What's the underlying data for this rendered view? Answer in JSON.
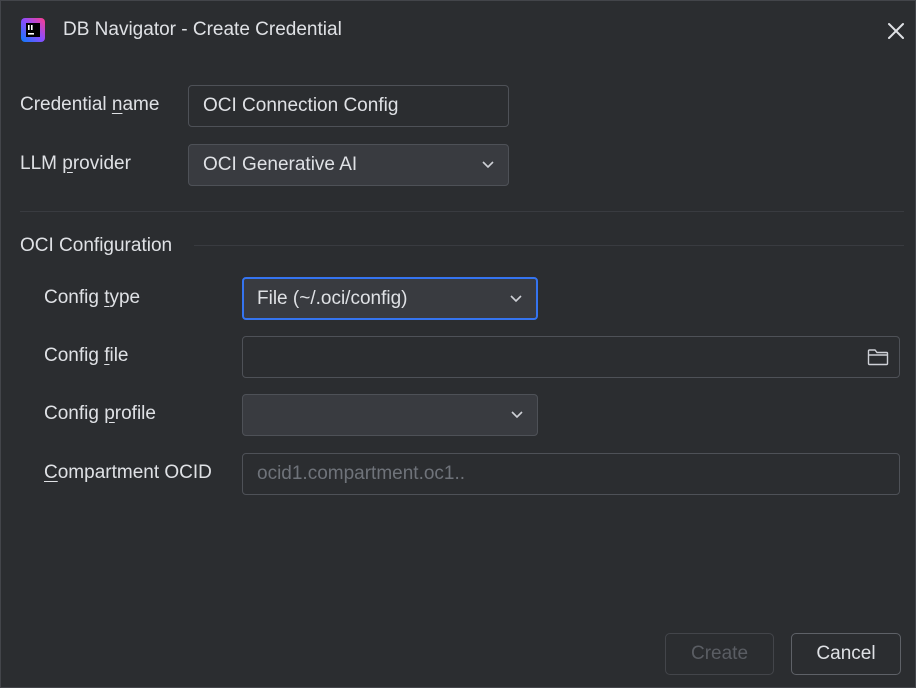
{
  "window": {
    "title": "DB Navigator - Create Credential",
    "app_icon": "jetbrains-app-icon",
    "close_icon": "close-icon"
  },
  "form": {
    "credential_name": {
      "label_pre": "Credential ",
      "label_mnemonic": "n",
      "label_post": "ame",
      "value": "OCI Connection Config"
    },
    "llm_provider": {
      "label_pre": "LLM ",
      "label_mnemonic": "p",
      "label_post": "rovider",
      "value": "OCI Generative AI"
    }
  },
  "oci_section": {
    "title": "OCI Configuration",
    "config_type": {
      "label_pre": "Config ",
      "label_mnemonic": "t",
      "label_post": "ype",
      "value": "File (~/.oci/config)"
    },
    "config_file": {
      "label_pre": "Config ",
      "label_mnemonic": "f",
      "label_post": "ile",
      "value": "",
      "icon": "folder-icon"
    },
    "config_profile": {
      "label_pre": "Config ",
      "label_mnemonic": "p",
      "label_post": "rofile",
      "value": ""
    },
    "compartment_ocid": {
      "label_pre": "",
      "label_mnemonic": "C",
      "label_post": "ompartment OCID",
      "value": "",
      "placeholder": "ocid1.compartment.oc1.."
    }
  },
  "buttons": {
    "create": "Create",
    "cancel": "Cancel"
  },
  "colors": {
    "background": "#2b2d30",
    "field_border": "#4e5157",
    "focus_border": "#3574f0",
    "text": "#dfe1e5",
    "placeholder": "#6f737a"
  }
}
